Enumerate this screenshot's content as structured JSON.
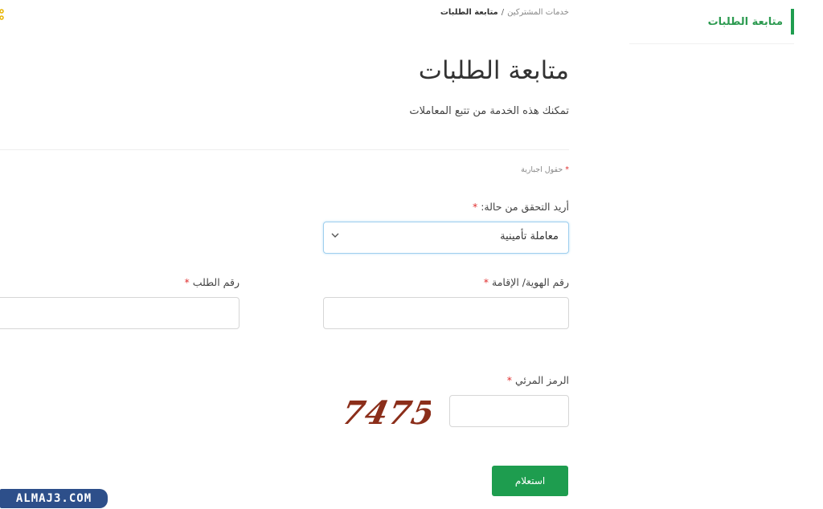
{
  "sidebar": {
    "items": [
      {
        "label": "متابعة الطلبات",
        "active": true
      }
    ]
  },
  "breadcrumb": {
    "parent": "خدمات المشتركين",
    "separator": "/",
    "current": "متابعة الطلبات"
  },
  "page": {
    "title": "متابعة الطلبات",
    "description": "تمكنك هذه الخدمة من تتبع المعاملات",
    "required_note": "حقول اجبارية"
  },
  "form": {
    "status_type": {
      "label": "أريد التحقق من حالة:",
      "selected": "معاملة تأمينية"
    },
    "id_number": {
      "label": "رقم الهوية/ الإقامة",
      "value": ""
    },
    "request_number": {
      "label": "رقم الطلب",
      "value": ""
    },
    "captcha": {
      "label": "الرمز المرئي",
      "image_text": "7475",
      "value": ""
    },
    "submit_label": "استعلام"
  },
  "watermark": {
    "text": "ALMAJ3.COM"
  },
  "colors": {
    "accent": "#1e9d4f",
    "required": "#e03030",
    "watermark_bg": "#2d4f8a",
    "captcha_ink": "#8b2e1a"
  }
}
